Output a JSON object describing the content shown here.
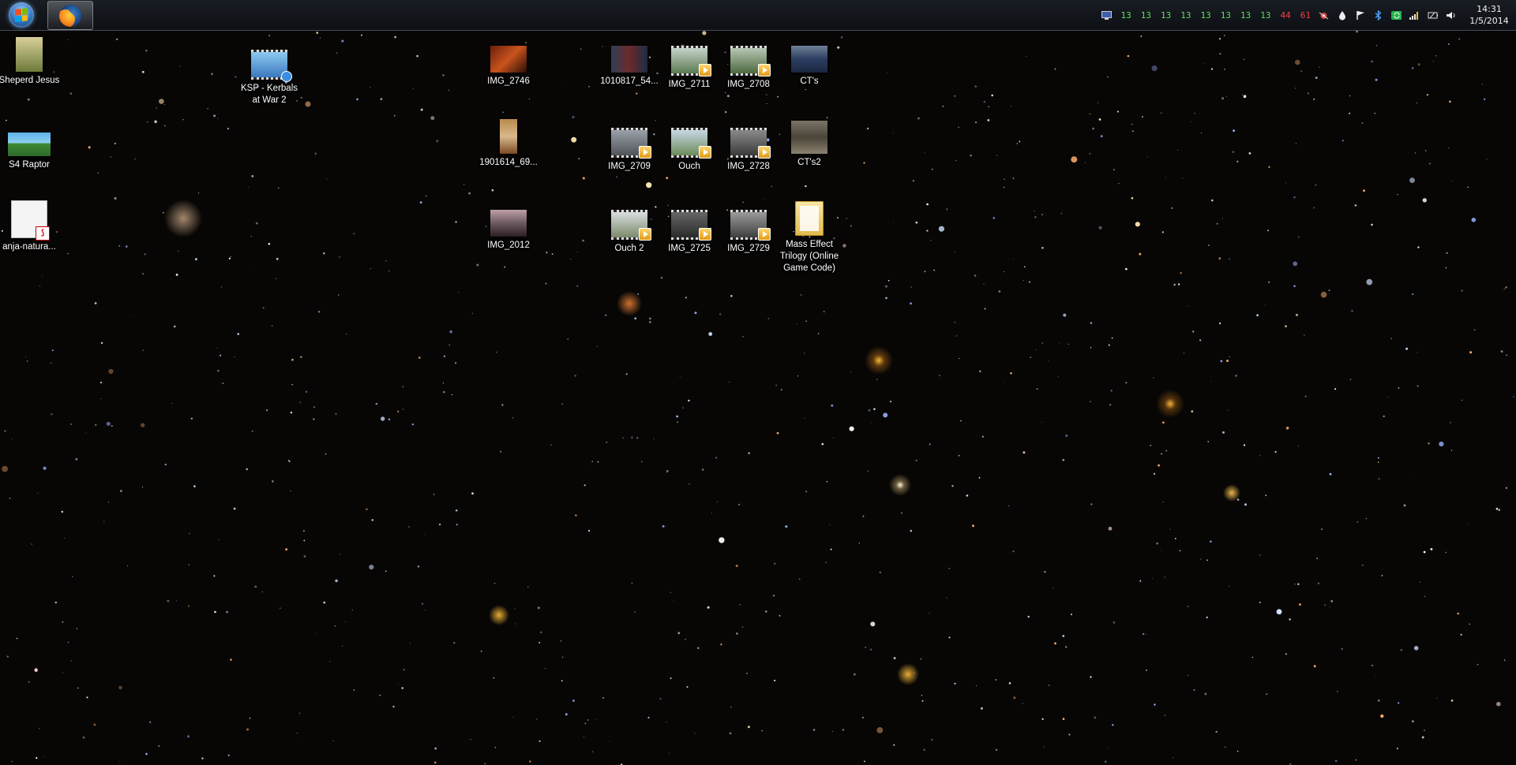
{
  "taskbar": {
    "start_button": "start-button",
    "apps": [
      {
        "name": "Firefox",
        "icon": "firefox-icon"
      }
    ]
  },
  "tray": {
    "counters": [
      {
        "value": "13",
        "color": "#5fe05f"
      },
      {
        "value": "13",
        "color": "#5fe05f"
      },
      {
        "value": "13",
        "color": "#5fe05f"
      },
      {
        "value": "13",
        "color": "#5fe05f"
      },
      {
        "value": "13",
        "color": "#5fe05f"
      },
      {
        "value": "13",
        "color": "#5fe05f"
      },
      {
        "value": "13",
        "color": "#5fe05f"
      },
      {
        "value": "13",
        "color": "#5fe05f"
      },
      {
        "value": "44",
        "color": "#ff3b3b"
      },
      {
        "value": "61",
        "color": "#ff3b3b"
      }
    ],
    "icons": [
      "network-monitor-icon",
      "bug-icon",
      "drop-icon",
      "action-center-flag-icon",
      "bluetooth-icon",
      "sync-icon",
      "signal-strength-icon",
      "power-icon",
      "volume-icon"
    ],
    "time": "14:31",
    "date": "1/5/2014"
  },
  "desktop": {
    "icons": [
      {
        "label": "Sheperd Jesus",
        "kind": "image"
      },
      {
        "label": "S4 Raptor",
        "kind": "image"
      },
      {
        "label": "anja-natura...",
        "kind": "pdf"
      },
      {
        "label": "KSP - Kerbals at War 2",
        "kind": "video-shortcut"
      },
      {
        "label": "IMG_2746",
        "kind": "image"
      },
      {
        "label": "1901614_69...",
        "kind": "image"
      },
      {
        "label": "IMG_2012",
        "kind": "image"
      },
      {
        "label": "1010817_54...",
        "kind": "image"
      },
      {
        "label": "IMG_2709",
        "kind": "video"
      },
      {
        "label": "Ouch 2",
        "kind": "video"
      },
      {
        "label": "IMG_2711",
        "kind": "video"
      },
      {
        "label": "Ouch",
        "kind": "video"
      },
      {
        "label": "IMG_2725",
        "kind": "video"
      },
      {
        "label": "IMG_2708",
        "kind": "video"
      },
      {
        "label": "IMG_2728",
        "kind": "video"
      },
      {
        "label": "IMG_2729",
        "kind": "video"
      },
      {
        "label": "CT's",
        "kind": "image"
      },
      {
        "label": "CT's2",
        "kind": "image"
      },
      {
        "label": "Mass Effect Trilogy (Online Game Code)",
        "kind": "folder"
      }
    ]
  }
}
